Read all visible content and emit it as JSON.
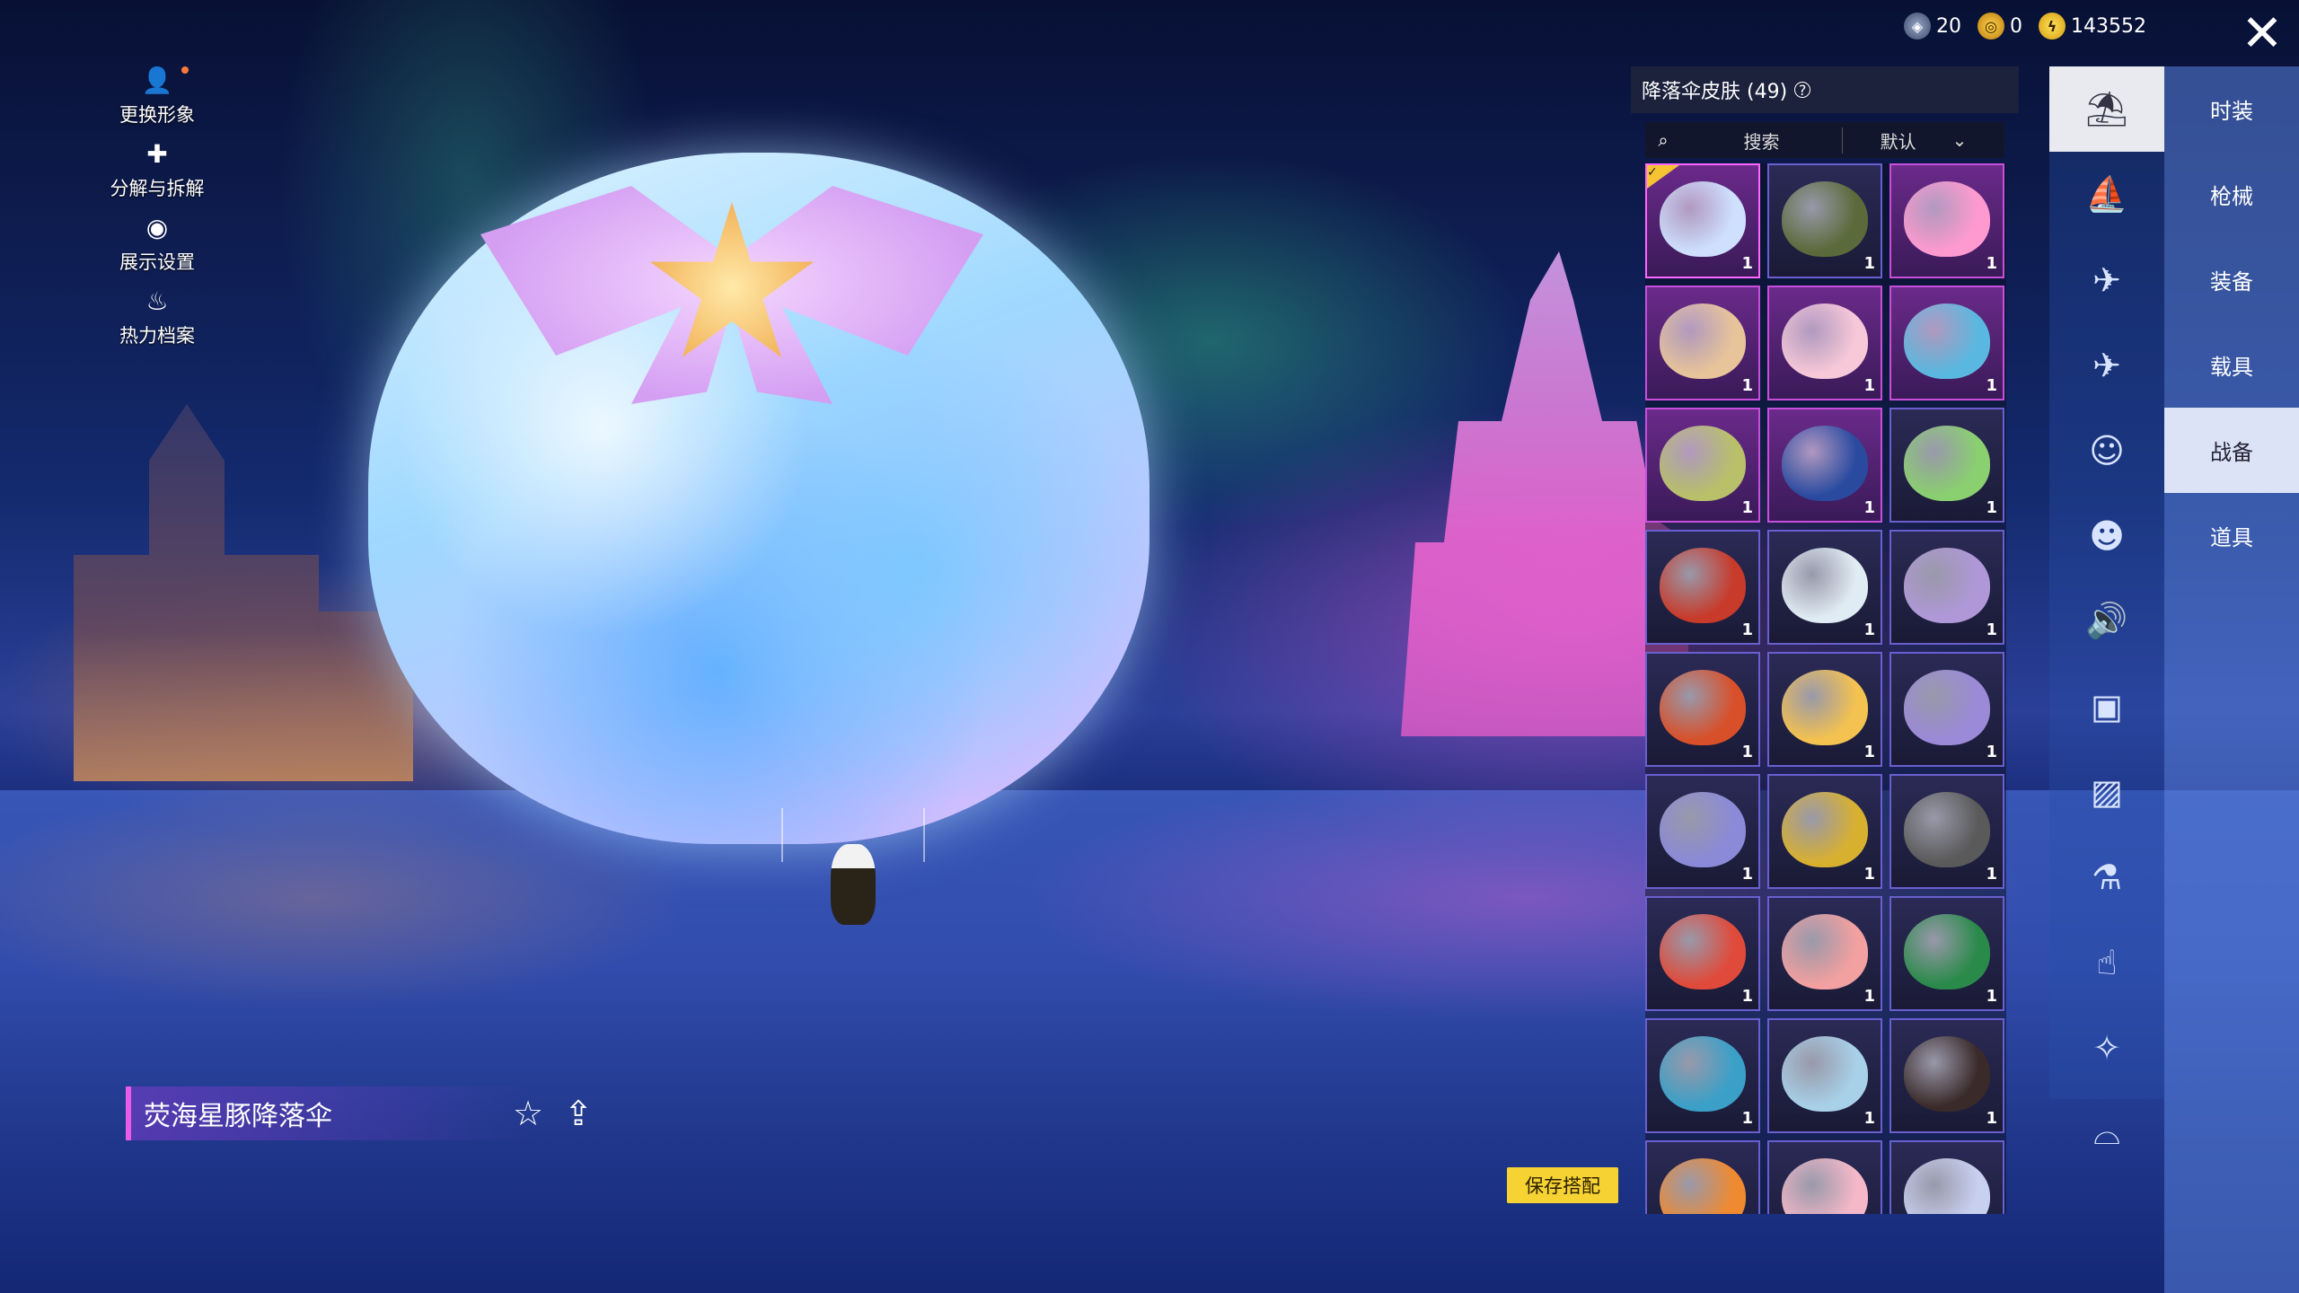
{
  "left_tools": [
    {
      "label": "更换形象",
      "icon": "avatar-icon"
    },
    {
      "label": "分解与拆解",
      "icon": "puzzle-icon"
    },
    {
      "label": "展示设置",
      "icon": "eye-icon"
    },
    {
      "label": "热力档案",
      "icon": "flame-icon"
    }
  ],
  "item": {
    "name": "荧海星豚降落伞"
  },
  "save_label": "保存搭配",
  "currency": [
    {
      "icon": "bp-coin-icon",
      "value": "20"
    },
    {
      "icon": "gold-coin-icon",
      "value": "0"
    },
    {
      "icon": "uc-icon",
      "value": "143552"
    }
  ],
  "panel": {
    "title": "降落伞皮肤 (49)",
    "search_placeholder": "搜索",
    "sort_value": "默认"
  },
  "grid_items": [
    {
      "qty": "1",
      "rarity": "rare",
      "selected": true,
      "color": "#cfe0ff"
    },
    {
      "qty": "1",
      "rarity": "normal",
      "color": "#5a6a3a"
    },
    {
      "qty": "1",
      "rarity": "rare",
      "color": "#ff9ad0"
    },
    {
      "qty": "1",
      "rarity": "rare",
      "color": "#e8c49a"
    },
    {
      "qty": "1",
      "rarity": "rare",
      "color": "#f7c8d8"
    },
    {
      "qty": "1",
      "rarity": "rare",
      "color": "#5ab8e0"
    },
    {
      "qty": "1",
      "rarity": "rare",
      "color": "#b8c06a"
    },
    {
      "qty": "1",
      "rarity": "rare",
      "color": "#2a4aa0"
    },
    {
      "qty": "1",
      "rarity": "normal",
      "color": "#8ad070"
    },
    {
      "qty": "1",
      "rarity": "normal",
      "color": "#c83a2a"
    },
    {
      "qty": "1",
      "rarity": "normal",
      "color": "#e0ecf4"
    },
    {
      "qty": "1",
      "rarity": "normal",
      "color": "#b098d8"
    },
    {
      "qty": "1",
      "rarity": "normal",
      "color": "#d8502a"
    },
    {
      "qty": "1",
      "rarity": "normal",
      "color": "#f4c250"
    },
    {
      "qty": "1",
      "rarity": "normal",
      "color": "#9a8ad8"
    },
    {
      "qty": "1",
      "rarity": "normal",
      "color": "#8a8ad8"
    },
    {
      "qty": "1",
      "rarity": "normal",
      "color": "#d8b030"
    },
    {
      "qty": "1",
      "rarity": "normal",
      "color": "#5a5a5a"
    },
    {
      "qty": "1",
      "rarity": "normal",
      "color": "#e04a3a"
    },
    {
      "qty": "1",
      "rarity": "normal",
      "color": "#f2a0a0"
    },
    {
      "qty": "1",
      "rarity": "normal",
      "color": "#2a8a4a"
    },
    {
      "qty": "1",
      "rarity": "normal",
      "color": "#3aa0c8"
    },
    {
      "qty": "1",
      "rarity": "normal",
      "color": "#a8d0e8"
    },
    {
      "qty": "1",
      "rarity": "normal",
      "color": "#3a2a2a"
    },
    {
      "qty": "",
      "rarity": "normal",
      "color": "#f08a30"
    },
    {
      "qty": "",
      "rarity": "normal",
      "color": "#f4b8c8"
    },
    {
      "qty": "",
      "rarity": "normal",
      "color": "#c8d0f0"
    }
  ],
  "icon_column": [
    {
      "icon": "parachute-icon",
      "active": true
    },
    {
      "icon": "boat-icon"
    },
    {
      "icon": "drone-icon"
    },
    {
      "icon": "plane-icon"
    },
    {
      "icon": "emote-icon"
    },
    {
      "icon": "companion-icon"
    },
    {
      "icon": "sound-icon"
    },
    {
      "icon": "frame-icon"
    },
    {
      "icon": "picture-icon"
    },
    {
      "icon": "spray-icon"
    },
    {
      "icon": "finger-icon"
    },
    {
      "icon": "sparkle-icon"
    },
    {
      "icon": "roast-icon"
    }
  ],
  "categories": [
    {
      "label": "时装"
    },
    {
      "label": "枪械"
    },
    {
      "label": "装备"
    },
    {
      "label": "载具"
    },
    {
      "label": "战备",
      "active": true
    },
    {
      "label": "道具"
    }
  ]
}
